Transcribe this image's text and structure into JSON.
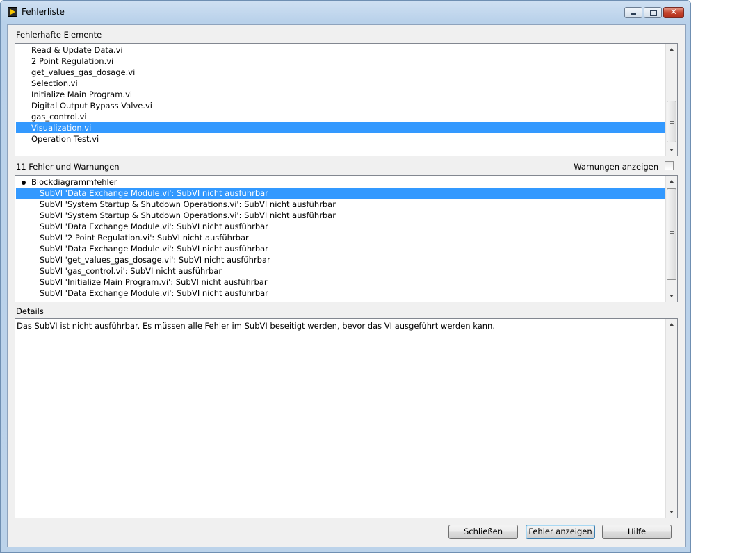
{
  "window": {
    "title": "Fehlerliste",
    "close_glyph": "✕"
  },
  "elements_section": {
    "label": "Fehlerhafte Elemente",
    "items": [
      "Read & Update Data.vi",
      "2 Point Regulation.vi",
      "get_values_gas_dosage.vi",
      "Selection.vi",
      "Initialize Main Program.vi",
      "Digital Output Bypass Valve.vi",
      "gas_control.vi",
      "Visualization.vi",
      "Operation Test.vi"
    ],
    "selected_index": 7
  },
  "errors_section": {
    "count_label": "11 Fehler und Warnungen",
    "show_warnings_label": "Warnungen anzeigen",
    "show_warnings_checked": false,
    "group_label": "Blockdiagrammfehler",
    "items": [
      "SubVI 'Data Exchange Module.vi': SubVI nicht ausführbar",
      "SubVI 'System Startup & Shutdown Operations.vi': SubVI nicht ausführbar",
      "SubVI 'System Startup & Shutdown Operations.vi': SubVI nicht ausführbar",
      "SubVI 'Data Exchange Module.vi': SubVI nicht ausführbar",
      "SubVI '2 Point Regulation.vi': SubVI nicht ausführbar",
      "SubVI 'Data Exchange Module.vi': SubVI nicht ausführbar",
      "SubVI 'get_values_gas_dosage.vi': SubVI nicht ausführbar",
      "SubVI 'gas_control.vi': SubVI nicht ausführbar",
      "SubVI 'Initialize Main Program.vi': SubVI nicht ausführbar",
      "SubVI 'Data Exchange Module.vi': SubVI nicht ausführbar"
    ],
    "selected_index": 0
  },
  "details_section": {
    "label": "Details",
    "text": "Das SubVI ist nicht ausführbar. Es müssen alle Fehler im SubVI beseitigt werden, bevor das VI ausgeführt werden kann."
  },
  "buttons": {
    "close": "Schließen",
    "show_error": "Fehler anzeigen",
    "help": "Hilfe"
  },
  "colors": {
    "selection": "#3399ff",
    "window_frame": "#b9d1ea"
  },
  "icons": {
    "app": "labview-run-arrow-icon"
  }
}
